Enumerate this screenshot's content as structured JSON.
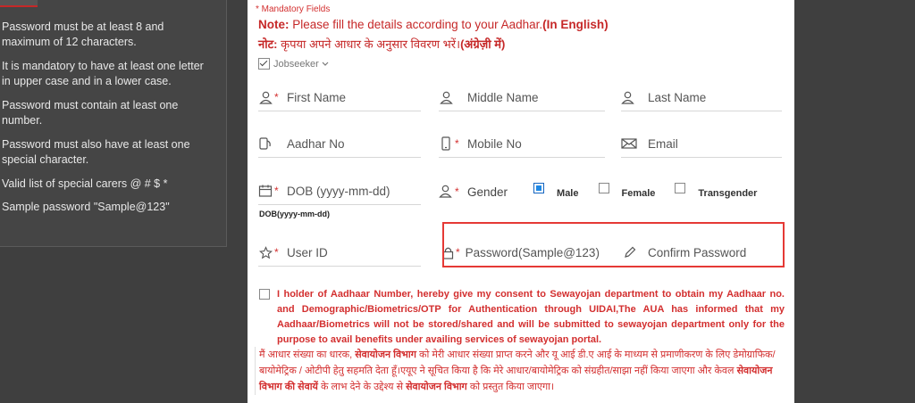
{
  "sidebar": {
    "rules": [
      "Password must be at least 8 and maximum of 12 characters.",
      "It is mandatory to have at least one letter in upper case and in a lower case.",
      "Password must contain at least one number.",
      "Password must also have at least one special character.",
      "Valid list of special carers @ # $ *",
      "Sample password \"Sample@123\""
    ]
  },
  "form": {
    "mandatory": "* Mandatory Fields",
    "note_label": "Note:",
    "note_text": " Please fill the details according to your Aadhar.",
    "note_bold": "(In English)",
    "note_hi_label": "नोट:",
    "note_hi_text": " कृपया अपने आधार के अनुसार विवरण भरें।",
    "note_hi_bold": "(अंग्रेज़ी में)",
    "user_type": "Jobseeker",
    "fields": {
      "first_name": "First Name",
      "middle_name": "Middle Name",
      "last_name": "Last Name",
      "aadhar": "Aadhar No",
      "mobile": "Mobile No",
      "email": "Email",
      "dob": "DOB (yyyy-mm-dd)",
      "user_id": "User ID",
      "password": "Password(Sample@123)",
      "confirm_password": "Confirm Password"
    },
    "gender_label": "Gender",
    "gender_options": [
      "Male",
      "Female",
      "Transgender"
    ],
    "gender_selected": "Male",
    "dob_hint": "DOB(yyyy-mm-dd)",
    "consent_en": "I holder of Aadhaar Number, hereby give my consent to Sewayojan department to obtain my Aadhaar no. and Demographic/Biometrics/OTP for Authentication through UIDAI,The AUA has informed that my Aadhaar/Biometrics will not be stored/shared and will be submitted to sewayojan department only for the purpose to avail benefits under availing services of sewayojan portal.",
    "consent_hi": {
      "p1": "मैं आधार संख्या का धारक, ",
      "b1": "सेवायोजन विभाग",
      "p2": " को मेरी आधार संख्या प्राप्त करने और यू आई डी.ए आई के माध्यम से प्रमाणीकरण के लिए डेमोग्राफिक/ बायोमेट्रिक / ओटीपी हेतु सहमति देता हूँ।एयूए ने सूचित किया है कि मेरे आधार/बायोमेट्रिक को संग्रहीत/साझा नहीं किया जाएगा और केवल ",
      "b2": "सेवायोजन विभाग की सेवायें",
      "p3": " के लाभ देने के उद्देश्य से ",
      "b3": "सेवायोजन विभाग",
      "p4": " को प्रस्तुत किया जाएगा।"
    }
  },
  "colors": {
    "required": "#d32f2f",
    "highlight_box": "#e53935",
    "radio_selected": "#1e88e5"
  }
}
